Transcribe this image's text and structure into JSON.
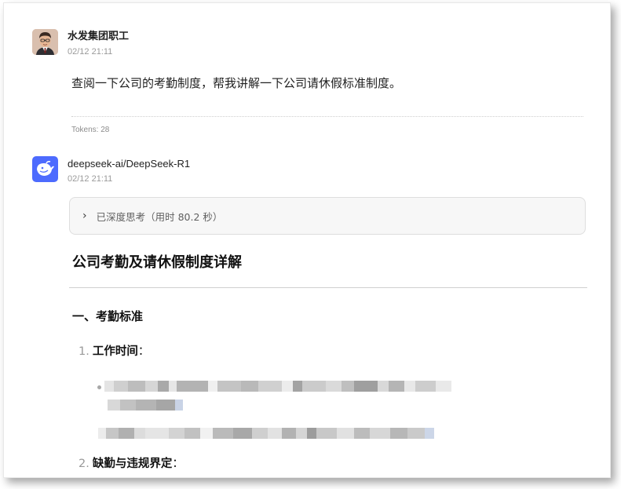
{
  "user_message": {
    "name": "水发集团职工",
    "time": "02/12 21:11",
    "text": "查阅一下公司的考勤制度，帮我讲解一下公司请休假标准制度。",
    "tokens": "Tokens: 28"
  },
  "bot_message": {
    "name": "deepseek-ai/DeepSeek-R1",
    "time": "02/12 21:11",
    "thinking_label": "已深度思考（用时 80.2 秒）",
    "heading": "公司考勤及请休假制度详解",
    "section_title": "一、考勤标准",
    "items": [
      {
        "number": "1.",
        "title": "工作时间",
        "colon": "："
      },
      {
        "number": "2.",
        "title": "缺勤与违规界定",
        "colon": "："
      }
    ]
  },
  "colors": {
    "bot_avatar": "#4d6bfe",
    "user_avatar_bg": "#d9bfae"
  },
  "icons": {
    "user_avatar": "user-avatar-icon",
    "bot_avatar": "deepseek-whale-icon",
    "expand": "chevron-right-icon"
  }
}
